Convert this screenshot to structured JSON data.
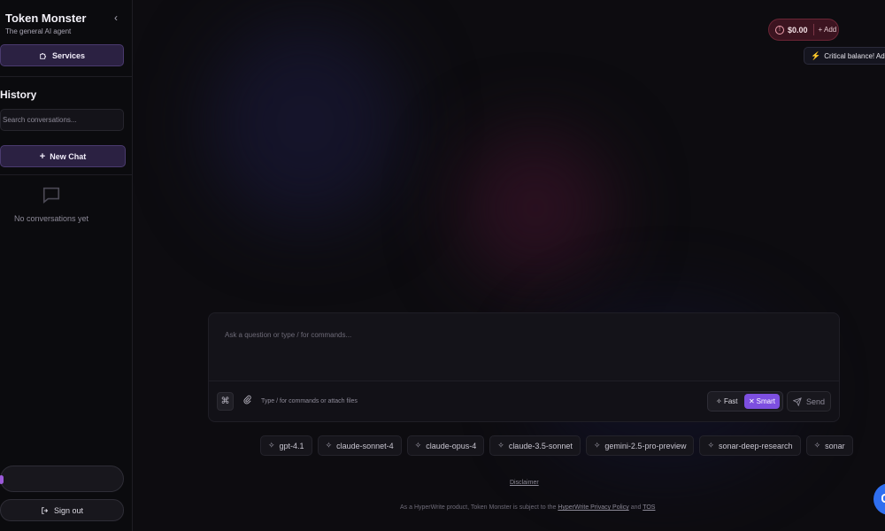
{
  "sidebar": {
    "brand_title": "Token Monster",
    "brand_subtitle": "The general AI agent",
    "collapse_icon": "chevron-left-icon",
    "services_label": "Services",
    "history_title": "History",
    "search_placeholder": "Search conversations...",
    "new_chat_label": "New Chat",
    "empty_text": "No conversations yet",
    "sign_out_label": "Sign out"
  },
  "balance": {
    "amount": "$0.00",
    "add_label": "Add",
    "critical_message": "Critical balance! Add credits"
  },
  "composer": {
    "placeholder": "Ask a question or type / for commands...",
    "hint": "Type / for commands or attach files",
    "mode_fast": "Fast",
    "mode_smart": "Smart",
    "selected_mode": "Smart",
    "send_label": "Send"
  },
  "models": [
    "gpt-4.1",
    "claude-sonnet-4",
    "claude-opus-4",
    "claude-3.5-sonnet",
    "gemini-2.5-pro-preview",
    "sonar-deep-research",
    "sonar"
  ],
  "footer": {
    "disclaimer": "Disclaimer",
    "prefix": "As a HyperWrite product, Token Monster is subject to the",
    "privacy_link": "HyperWrite Privacy Policy",
    "and": "and",
    "tos_link": "TOS"
  },
  "colors": {
    "accent": "#7d4fe0",
    "balance_bg": "#3c1420",
    "background": "#0d0c10"
  }
}
